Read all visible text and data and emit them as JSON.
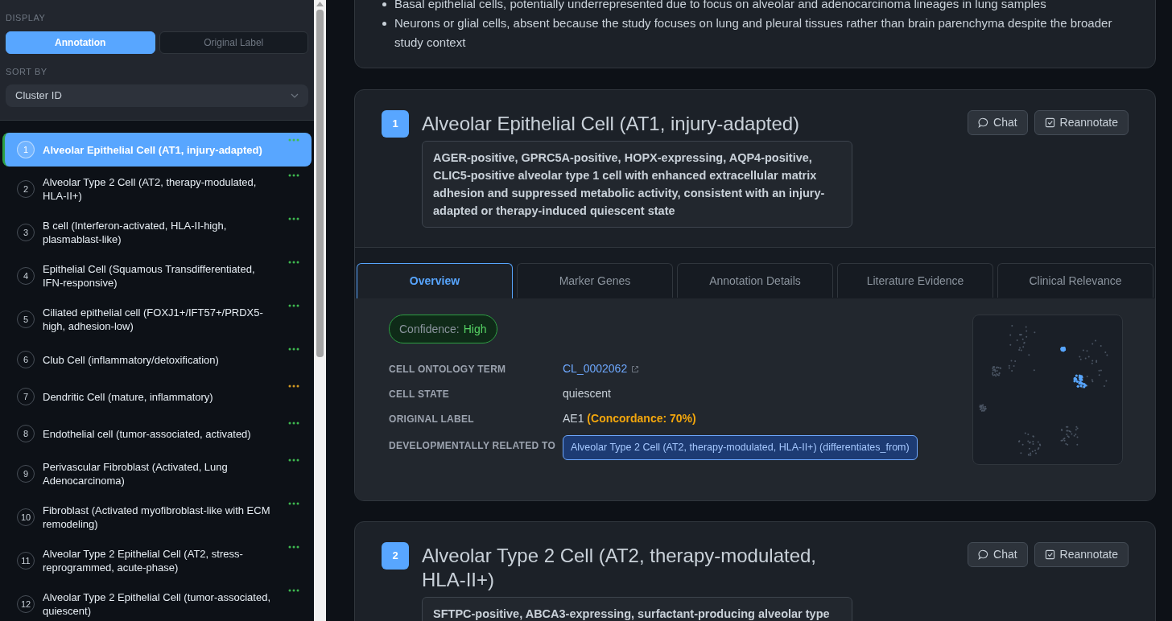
{
  "sidebar": {
    "display_heading": "DISPLAY",
    "display_options": [
      {
        "label": "Annotation",
        "selected": true
      },
      {
        "label": "Original Label",
        "selected": false
      }
    ],
    "sort_heading": "SORT BY",
    "sort_select": {
      "value": "Cluster ID"
    },
    "clusters": [
      {
        "number": "1",
        "name": "Alveolar Epithelial Cell (AT1, injury-adapted)",
        "selected": true,
        "color": "#3fb950"
      },
      {
        "number": "2",
        "name": "Alveolar Type 2 Cell (AT2, therapy-modulated, HLA-II+)",
        "selected": false,
        "color": "#3fb950"
      },
      {
        "number": "3",
        "name": "B cell (Interferon-activated, HLA-II-high, plasmablast-like)",
        "selected": false,
        "color": "#3fb950"
      },
      {
        "number": "4",
        "name": "Epithelial Cell (Squamous Transdifferentiated, IFN-responsive)",
        "selected": false,
        "color": "#3fb950"
      },
      {
        "number": "5",
        "name": "Ciliated epithelial cell (FOXJ1+/IFT57+/PRDX5-high, adhesion-low)",
        "selected": false,
        "color": "#3fb950"
      },
      {
        "number": "6",
        "name": "Club Cell (inflammatory/detoxification)",
        "selected": false,
        "color": "#3fb950"
      },
      {
        "number": "7",
        "name": "Dendritic Cell (mature, inflammatory)",
        "selected": false,
        "color": "#d29922"
      },
      {
        "number": "8",
        "name": "Endothelial cell (tumor-associated, activated)",
        "selected": false,
        "color": "#3fb950"
      },
      {
        "number": "9",
        "name": "Perivascular Fibroblast (Activated, Lung Adenocarcinoma)",
        "selected": false,
        "color": "#3fb950"
      },
      {
        "number": "10",
        "name": "Fibroblast (Activated myofibroblast-like with ECM remodeling)",
        "selected": false,
        "color": "#3fb950"
      },
      {
        "number": "11",
        "name": "Alveolar Type 2 Epithelial Cell (AT2, stress-reprogrammed, acute-phase)",
        "selected": false,
        "color": "#3fb950"
      },
      {
        "number": "12",
        "name": "Alveolar Type 2 Epithelial Cell (tumor-associated, quiescent)",
        "selected": false,
        "color": "#3fb950"
      }
    ]
  },
  "summary_card": {
    "bullets": [
      "Basal epithelial cells, potentially underrepresented due to focus on alveolar and adenocarcinoma lineages in lung samples",
      "Neurons or glial cells, absent because the study focuses on lung and pleural tissues rather than brain parenchyma despite the broader study context"
    ]
  },
  "cluster_cards": [
    {
      "number": "1",
      "title": "Alveolar Epithelial Cell (AT1, injury-adapted)",
      "description": "AGER-positive, GPRC5A-positive, HOPX-expressing, AQP4-positive, CLIC5-positive alveolar type 1 cell with enhanced extracellular matrix adhesion and suppressed metabolic activity, consistent with an injury-adapted or therapy-induced quiescent state",
      "buttons": [
        {
          "label": "Chat",
          "kind": "chat"
        },
        {
          "label": "Reannotate",
          "kind": "reannotate"
        }
      ],
      "tabs": [
        {
          "label": "Overview",
          "selected": true
        },
        {
          "label": "Marker Genes",
          "selected": false
        },
        {
          "label": "Annotation Details",
          "selected": false
        },
        {
          "label": "Literature Evidence",
          "selected": false
        },
        {
          "label": "Clinical Relevance",
          "selected": false
        }
      ],
      "overview": {
        "confidence": {
          "label": "Confidence:",
          "value": "High"
        },
        "fields": [
          {
            "label": "CELL ONTOLOGY TERM",
            "kind": "link",
            "value": "CL_0002062"
          },
          {
            "label": "CELL STATE",
            "kind": "text",
            "value": "quiescent"
          },
          {
            "label": "ORIGINAL LABEL",
            "kind": "label",
            "value": "AE1",
            "note": "(Concordance: 70%)"
          },
          {
            "label": "DEVELOPMENTALLY RELATED TO",
            "kind": "tag",
            "value": "Alveolar Type 2 Cell (AT2, therapy-modulated, HLA-II+) (differentiates_from)"
          }
        ]
      }
    },
    {
      "number": "2",
      "title": "Alveolar Type 2 Cell (AT2, therapy-modulated, HLA-II+)",
      "description": "SFTPC-positive, ABCA3-expressing, surfactant-producing alveolar type",
      "buttons": [
        {
          "label": "Chat",
          "kind": "chat"
        },
        {
          "label": "Reannotate",
          "kind": "reannotate"
        }
      ]
    }
  ]
}
